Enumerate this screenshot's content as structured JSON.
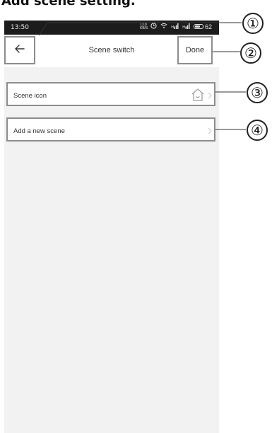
{
  "doc": {
    "heading": "Add scene setting."
  },
  "status_bar": {
    "time": "13:50",
    "network_badge": "13.8 KB/S",
    "battery": "62"
  },
  "nav": {
    "back_icon": "arrow-left-icon",
    "title": "Scene switch",
    "done_label": "Done"
  },
  "rows": [
    {
      "label": "Scene icon",
      "icon": "home-outline-icon"
    },
    {
      "label": "Add a new scene"
    }
  ],
  "callouts": [
    "①",
    "②",
    "③",
    "④"
  ],
  "colors": {
    "status_bar_bg": "#1c1c1c",
    "page_bg": "#f2f2f2",
    "callout_border": "#8d8d8d"
  }
}
